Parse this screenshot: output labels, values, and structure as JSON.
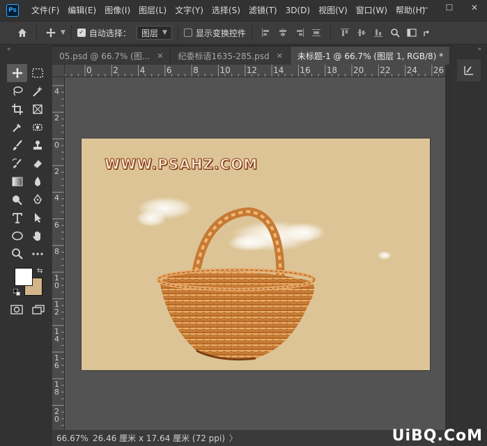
{
  "app": {
    "logo": "Ps"
  },
  "menu": [
    "文件(F)",
    "编辑(E)",
    "图像(I)",
    "图层(L)",
    "文字(Y)",
    "选择(S)",
    "滤镜(T)",
    "3D(D)",
    "视图(V)",
    "窗口(W)",
    "帮助(H)"
  ],
  "window_controls": {
    "minimize": "—",
    "restore": "☐",
    "close": "✕"
  },
  "options": {
    "auto_select_label": "自动选择：",
    "auto_select_checked": true,
    "auto_select_value": "图层",
    "show_transform_label": "显示变换控件",
    "show_transform_checked": false
  },
  "tabs": [
    {
      "label": "05.psd @ 66.7% (图...",
      "active": false
    },
    {
      "label": "纪委标语1635-285.psd",
      "active": false
    },
    {
      "label": "未标题-1 @ 66.7% (图层 1, RGB/8) *",
      "active": true
    }
  ],
  "ruler_top_labels": [
    "0",
    "2",
    "4",
    "6",
    "8",
    "10",
    "12",
    "14",
    "16",
    "18",
    "20",
    "22",
    "24",
    "26"
  ],
  "ruler_left_labels": [
    "4",
    "2",
    "0",
    "2",
    "4",
    "6",
    "8",
    "1\n0",
    "1\n2",
    "1\n4",
    "1\n6",
    "1\n8",
    "2\n0"
  ],
  "canvas": {
    "background": "#dcc496",
    "watermark": "WWW.PSAHZ.COM"
  },
  "status": {
    "zoom": "66.67%",
    "doc_info": "26.46 厘米 x 17.64 厘米 (72 ppi)",
    "arrow": "〉"
  },
  "colors": {
    "foreground": "#ffffff",
    "background": "#d4b589"
  },
  "site_mark": "UiBQ.CoM"
}
